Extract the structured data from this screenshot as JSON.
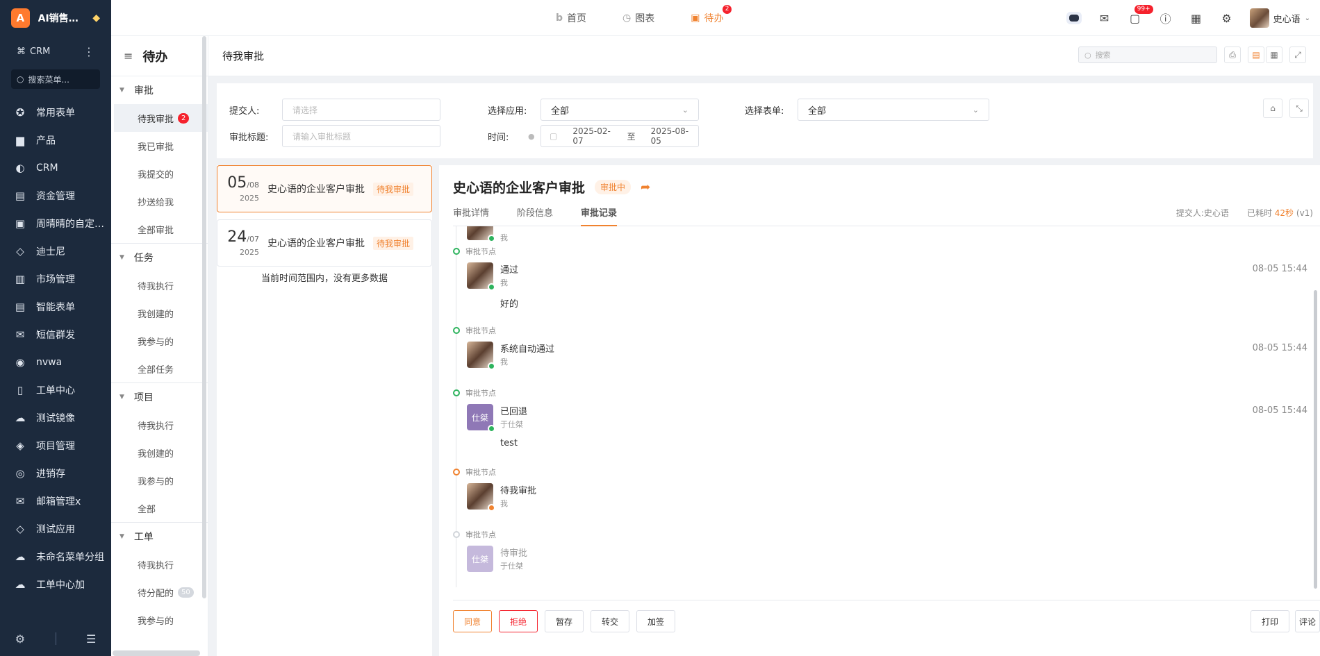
{
  "brand": {
    "initial": "A",
    "name": "AI销售助…",
    "gem": "◆"
  },
  "crm": {
    "label": "CRM"
  },
  "nav_search": {
    "placeholder": "搜索菜单..."
  },
  "nav_items": [
    {
      "label": "常用表单",
      "icon": "star-icon"
    },
    {
      "label": "产品",
      "icon": "cube-icon"
    },
    {
      "label": "CRM",
      "icon": "pie-icon"
    },
    {
      "label": "资金管理",
      "icon": "money-icon"
    },
    {
      "label": "周晴晴的自定…",
      "icon": "layout-icon"
    },
    {
      "label": "迪士尼",
      "icon": "gem-icon"
    },
    {
      "label": "市场管理",
      "icon": "briefcase-icon"
    },
    {
      "label": "智能表单",
      "icon": "form-icon"
    },
    {
      "label": "短信群发",
      "icon": "mail-icon"
    },
    {
      "label": "nvwa",
      "icon": "circle-icon"
    },
    {
      "label": "工单中心",
      "icon": "clipboard-icon"
    },
    {
      "label": "测试镜像",
      "icon": "cloud-icon"
    },
    {
      "label": "项目管理",
      "icon": "layers-icon"
    },
    {
      "label": "进销存",
      "icon": "dollar-icon"
    },
    {
      "label": "邮箱管理x",
      "icon": "envelope-icon"
    },
    {
      "label": "测试应用",
      "icon": "gem-icon"
    },
    {
      "label": "未命名菜单分组",
      "icon": "cloud-icon"
    },
    {
      "label": "工单中心加",
      "icon": "cloud-icon"
    }
  ],
  "top_tabs": [
    {
      "label": "首页"
    },
    {
      "label": "图表"
    },
    {
      "label": "待办",
      "badge": "2"
    }
  ],
  "top_icons": {
    "message_badge": "99+"
  },
  "user": {
    "name": "史心语"
  },
  "sub_nav": {
    "title": "待办",
    "groups": [
      {
        "label": "审批",
        "items": [
          {
            "label": "待我审批",
            "count": "2"
          },
          {
            "label": "我已审批"
          },
          {
            "label": "我提交的"
          },
          {
            "label": "抄送给我"
          },
          {
            "label": "全部审批"
          }
        ]
      },
      {
        "label": "任务",
        "items": [
          {
            "label": "待我执行"
          },
          {
            "label": "我创建的"
          },
          {
            "label": "我参与的"
          },
          {
            "label": "全部任务"
          }
        ]
      },
      {
        "label": "项目",
        "items": [
          {
            "label": "待我执行"
          },
          {
            "label": "我创建的"
          },
          {
            "label": "我参与的"
          },
          {
            "label": "全部"
          }
        ]
      },
      {
        "label": "工单",
        "items": [
          {
            "label": "待我执行"
          },
          {
            "label": "待分配的",
            "count": "50"
          },
          {
            "label": "我参与的"
          }
        ]
      }
    ]
  },
  "page": {
    "title": "待我审批",
    "search_placeholder": "搜索"
  },
  "filter": {
    "submitter_label": "提交人:",
    "submitter_placeholder": "请选择",
    "app_label": "选择应用:",
    "app_value": "全部",
    "form_label": "选择表单:",
    "form_value": "全部",
    "title_label": "审批标题:",
    "title_placeholder": "请输入审批标题",
    "time_label": "时间:",
    "date_start": "2025-02-07",
    "date_sep": "至",
    "date_end": "2025-08-05"
  },
  "list": {
    "cards": [
      {
        "day": "05",
        "month": "/08",
        "year": "2025",
        "title": "史心语的企业客户审批",
        "tag": "待我审批"
      },
      {
        "day": "24",
        "month": "/07",
        "year": "2025",
        "title": "史心语的企业客户审批",
        "tag": "待我审批"
      }
    ],
    "no_more": "当前时间范围内，没有更多数据"
  },
  "detail": {
    "title": "史心语的企业客户审批",
    "status": "审批中",
    "tabs": [
      "审批详情",
      "阶段信息",
      "审批记录"
    ],
    "submitter": "提交人:史心语",
    "elapsed_label": "已耗时",
    "elapsed_value": "42秒",
    "version": "(v1)",
    "node_label": "审批节点",
    "records": [
      {
        "action": "通过",
        "user": "我",
        "comment": "好的",
        "time": "08-05 15:44"
      },
      {
        "action": "系统自动通过",
        "user": "我",
        "comment": "",
        "time": "08-05 15:44"
      },
      {
        "action": "已回退",
        "user": "于仕桀",
        "comment": "test",
        "time": "08-05 15:44",
        "avatar_text": "仕桀"
      },
      {
        "action": "待我审批",
        "user": "我",
        "comment": "",
        "time": ""
      },
      {
        "action": "待审批",
        "user": "于仕桀",
        "comment": "",
        "time": "",
        "avatar_text": "仕桀"
      }
    ],
    "top_partial_user": "我"
  },
  "actions": {
    "agree": "同意",
    "reject": "拒绝",
    "save": "暂存",
    "transfer": "转交",
    "add_sign": "加签",
    "print": "打印",
    "comment": "评论"
  }
}
